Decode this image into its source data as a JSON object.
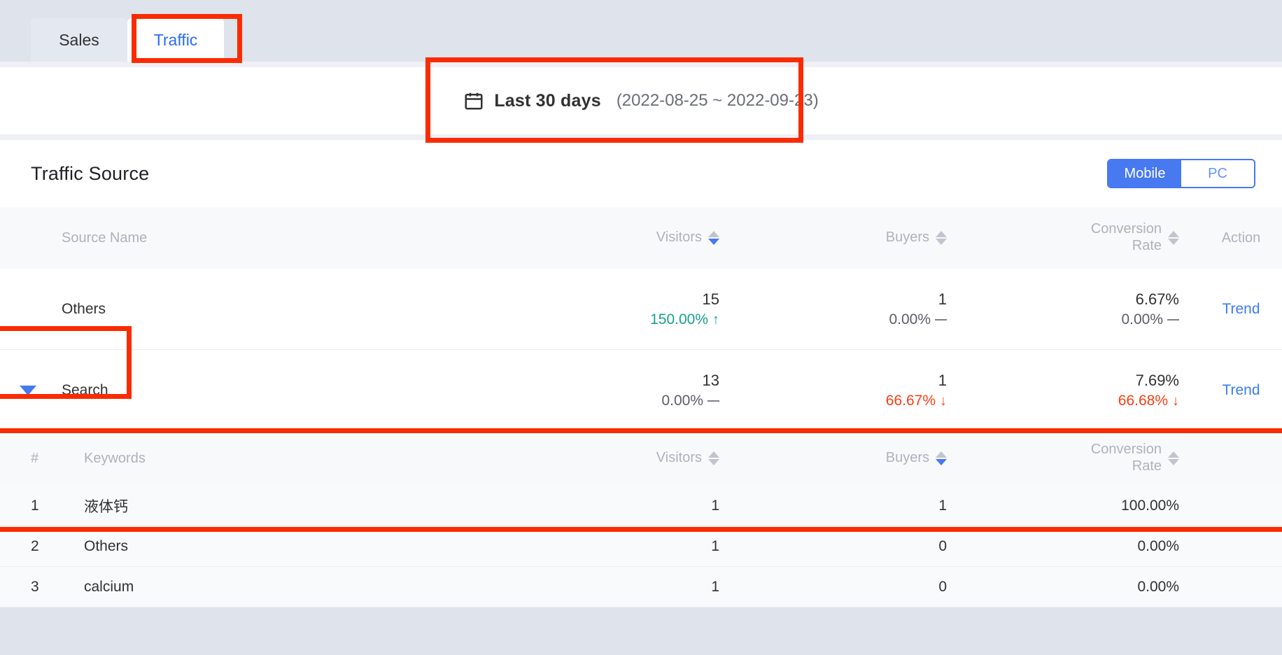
{
  "tabs": [
    {
      "label": "Sales",
      "active": false
    },
    {
      "label": "Traffic",
      "active": true
    }
  ],
  "date_filter": {
    "icon": "calendar-icon",
    "label": "Last 30 days",
    "range": "(2022-08-25 ~ 2022-09-23)"
  },
  "card": {
    "title": "Traffic Source",
    "device_toggle": {
      "options": [
        "Mobile",
        "PC"
      ],
      "selected": "Mobile"
    }
  },
  "source_table": {
    "headers": {
      "name": "Source Name",
      "visitors": "Visitors",
      "buyers": "Buyers",
      "conversion_line1": "Conversion",
      "conversion_line2": "Rate",
      "action": "Action"
    },
    "sort": {
      "column": "Visitors",
      "direction": "desc"
    },
    "rows": [
      {
        "name": "Others",
        "expandable": false,
        "visitors": "15",
        "visitors_delta": "150.00%",
        "visitors_trend": "up",
        "buyers": "1",
        "buyers_delta": "0.00%",
        "buyers_trend": "flat",
        "conversion": "6.67%",
        "conversion_delta": "0.00%",
        "conversion_trend": "flat",
        "action": "Trend"
      },
      {
        "name": "Search",
        "expandable": true,
        "expanded": true,
        "visitors": "13",
        "visitors_delta": "0.00%",
        "visitors_trend": "flat",
        "buyers": "1",
        "buyers_delta": "66.67%",
        "buyers_trend": "down",
        "conversion": "7.69%",
        "conversion_delta": "66.68%",
        "conversion_trend": "down",
        "action": "Trend"
      }
    ]
  },
  "keyword_table": {
    "headers": {
      "index": "#",
      "keyword": "Keywords",
      "visitors": "Visitors",
      "buyers": "Buyers",
      "conversion_line1": "Conversion",
      "conversion_line2": "Rate"
    },
    "sort": {
      "column": "Buyers",
      "direction": "desc"
    },
    "rows": [
      {
        "index": "1",
        "keyword": "液体钙",
        "visitors": "1",
        "buyers": "1",
        "conversion": "100.00%"
      },
      {
        "index": "2",
        "keyword": "Others",
        "visitors": "1",
        "buyers": "0",
        "conversion": "0.00%"
      },
      {
        "index": "3",
        "keyword": "calcium",
        "visitors": "1",
        "buyers": "0",
        "conversion": "0.00%"
      }
    ]
  },
  "colors": {
    "accent": "#4779f0",
    "link": "#3b7cf6",
    "up": "#17a28c",
    "down": "#fa3e14",
    "highlight": "#fb2b00"
  },
  "glyphs": {
    "arrow_up": "↑",
    "arrow_down": "↓"
  }
}
